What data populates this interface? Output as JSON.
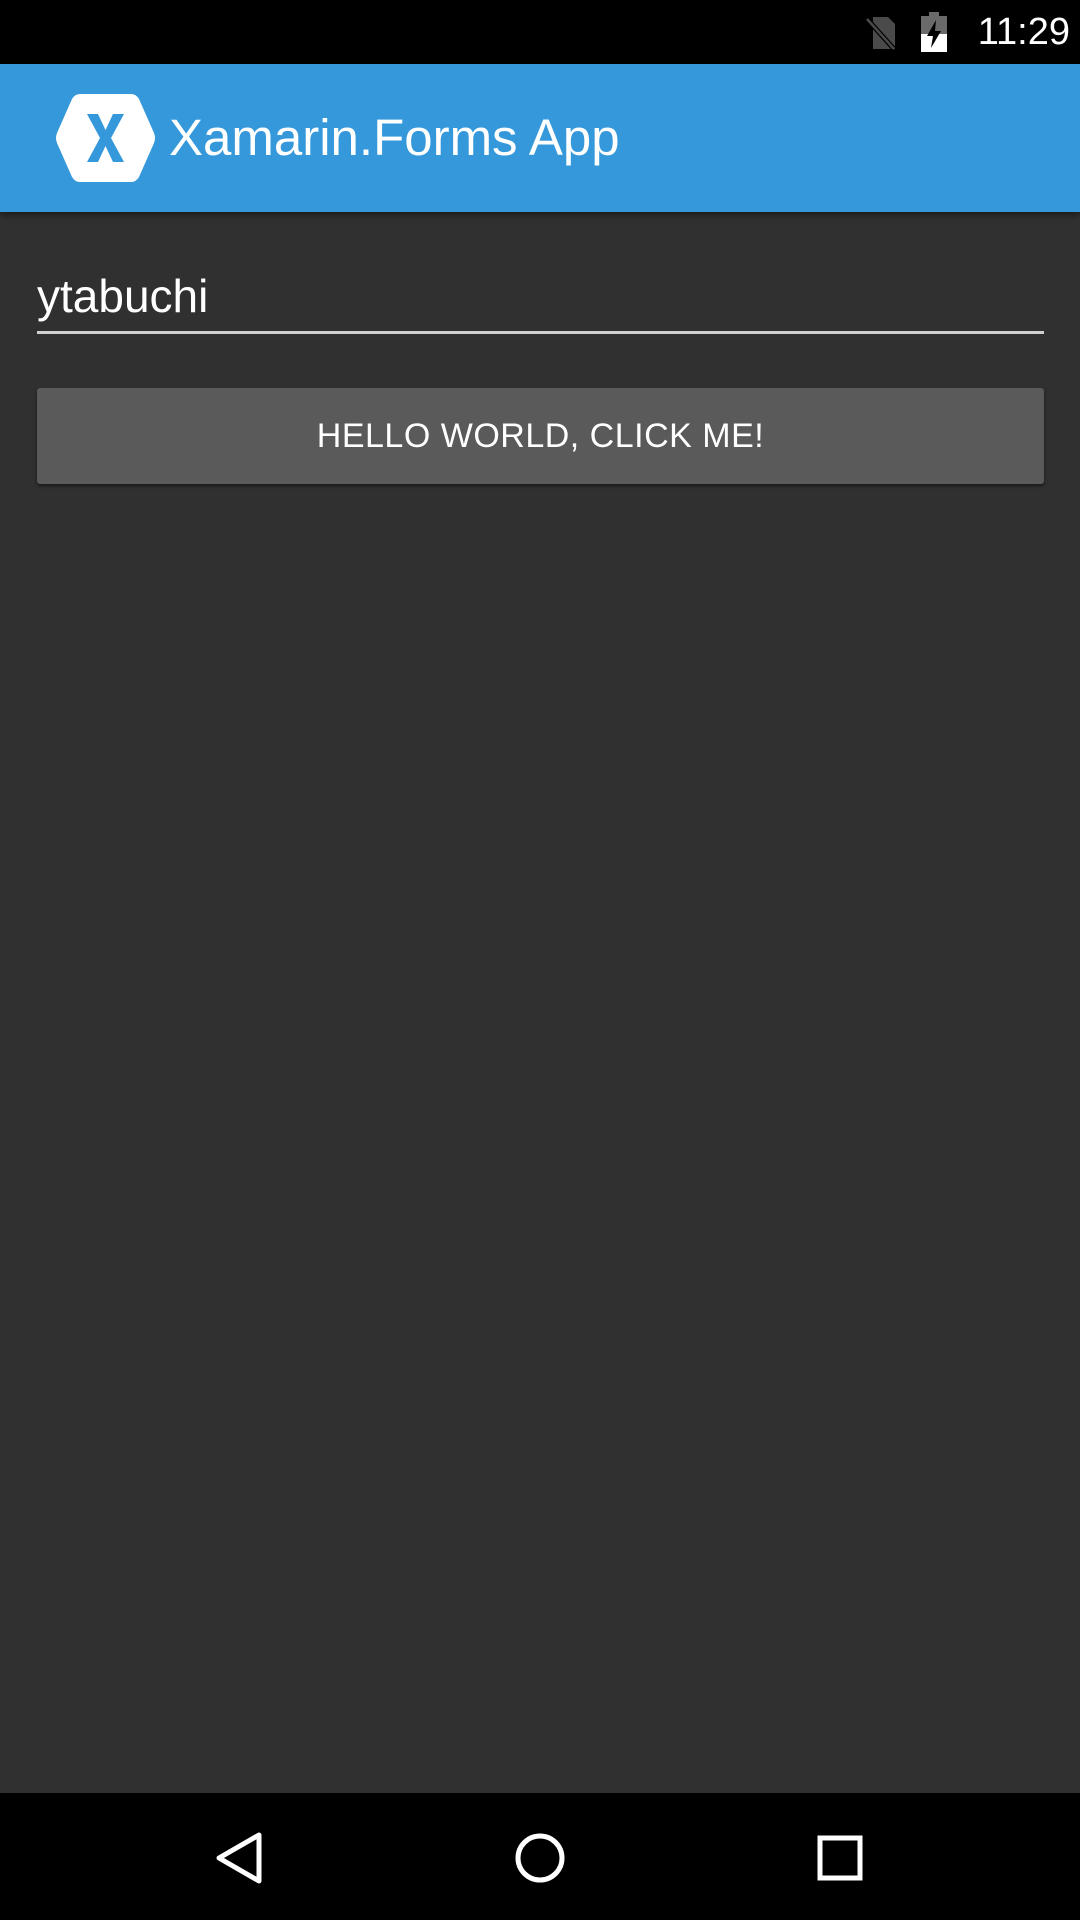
{
  "status_bar": {
    "time": "11:29",
    "icons": [
      "no-sim-icon",
      "battery-charging-icon"
    ]
  },
  "action_bar": {
    "title": "Xamarin.Forms App",
    "logo_icon": "xamarin-logo-icon",
    "background_color": "#3498db"
  },
  "main": {
    "entry": {
      "value": "ytabuchi"
    },
    "button": {
      "label": "HELLO WORLD, CLICK ME!"
    },
    "background_color": "#303030"
  },
  "nav_bar": {
    "icons": [
      "back-icon",
      "home-icon",
      "recents-icon"
    ]
  }
}
